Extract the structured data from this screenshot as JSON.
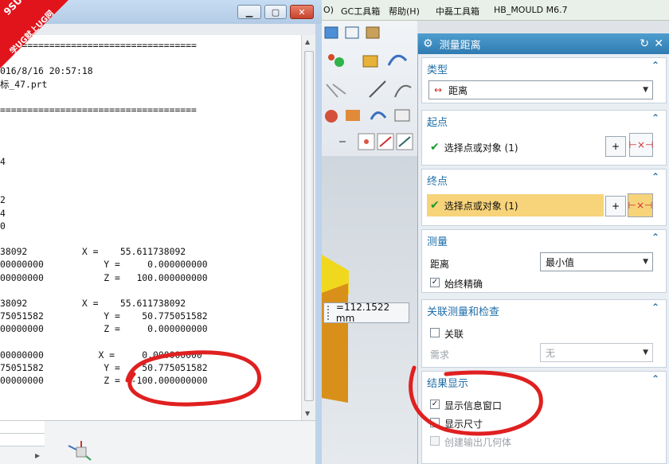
{
  "nx_menubar": {
    "items": [
      "O)",
      "GC工具箱",
      "帮助(H)",
      "中磊工具箱",
      "HB_MOULD M6.7"
    ]
  },
  "logo": {
    "line1": "9SUG",
    "line2": "学UG就上UG网"
  },
  "info_window": {
    "lines": [
      "====================================",
      "",
      "016/8/16 20:57:18",
      "标_47.prt",
      "",
      "====================================",
      "",
      "",
      "",
      "4",
      "",
      "",
      "2",
      "4",
      "0",
      "",
      "38092          X =    55.611738092",
      "00000000           Y =     0.000000000",
      "00000000           Z =   100.000000000",
      "",
      "38092          X =    55.611738092",
      "75051582           Y =    50.775051582",
      "00000000           Z =     0.000000000",
      "",
      "00000000          X =     0.000000000",
      "75051582           Y =    50.775051582",
      "00000000           Z =  -100.000000000"
    ]
  },
  "viewport": {
    "measure_value": "=112.1522 mm"
  },
  "dialog": {
    "title": "测量距离",
    "sections": {
      "type": {
        "header": "类型",
        "dropdown_value": "距离"
      },
      "start_point": {
        "header": "起点",
        "selection_label": "选择点或对象 (1)"
      },
      "end_point": {
        "header": "终点",
        "selection_label": "选择点或对象 (1)"
      },
      "measure": {
        "header": "测量",
        "distance_label": "距离",
        "distance_value": "最小值",
        "always_accurate_label": "始终精确"
      },
      "associate": {
        "header": "关联测量和检查",
        "associate_label": "关联",
        "requirement_label": "需求",
        "requirement_value": "无"
      },
      "results": {
        "header": "结果显示",
        "show_info_window_label": "显示信息窗口",
        "show_dimension_label": "显示尺寸",
        "create_output_geometry_label": "创建输出几何体"
      }
    },
    "checkboxes": {
      "always_accurate": true,
      "associate": false,
      "show_info_window": true,
      "show_dimension": false,
      "create_output_geometry": false
    }
  },
  "colors": {
    "dialog_title_bar": "#2f7bb2",
    "highlight": "#f7d37a",
    "annotation_red": "#e02020",
    "logo_red": "#e1141c",
    "check_green": "#1a9b2a"
  }
}
